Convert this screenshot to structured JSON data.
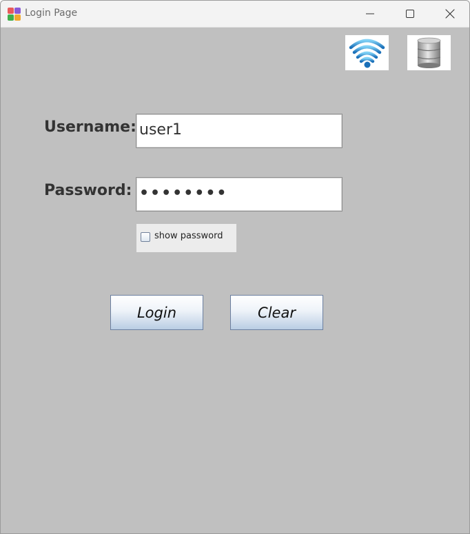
{
  "window": {
    "title": "Login Page",
    "minimize_icon": "minimize-icon",
    "maximize_icon": "maximize-icon",
    "close_icon": "close-icon"
  },
  "toolbar": {
    "wifi_icon": "wifi-icon",
    "database_icon": "database-icon"
  },
  "form": {
    "username_label": "Username:",
    "username_value": "user1",
    "password_label": "Password:",
    "password_masked": "••••••••",
    "show_password_label": "show password",
    "show_password_checked": false
  },
  "buttons": {
    "login_label": "Login",
    "clear_label": "Clear"
  },
  "colors": {
    "background": "#c0c0c0",
    "titlebar": "#f3f3f3",
    "button_gradient_bottom": "#b9cde3"
  }
}
